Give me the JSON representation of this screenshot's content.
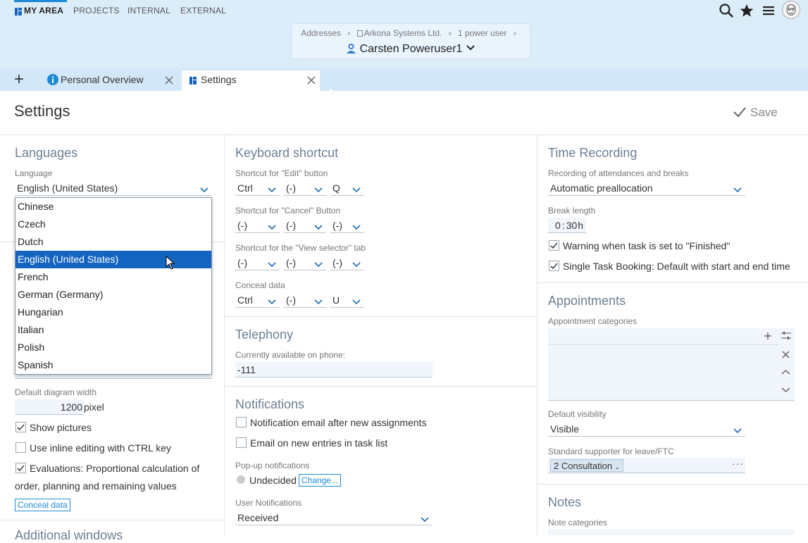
{
  "nav": {
    "items": [
      "MY AREA",
      "PROJECTS",
      "INTERNAL",
      "EXTERNAL"
    ]
  },
  "breadcrumb": {
    "items": [
      "Addresses",
      "Arkona Systems Ltd.",
      "1 power user"
    ],
    "separator": "›",
    "current": "Carsten Poweruser1"
  },
  "tabs": {
    "add": "+",
    "items": [
      {
        "label": "Personal Overview"
      },
      {
        "label": "Settings"
      }
    ]
  },
  "page": {
    "title": "Settings",
    "save_label": "Save"
  },
  "languages": {
    "heading": "Languages",
    "language_label": "Language",
    "language_value": "English (United States)",
    "options": [
      "Chinese",
      "Czech",
      "Dutch",
      "English (United States)",
      "French",
      "German (Germany)",
      "Hungarian",
      "Italian",
      "Polish",
      "Spanish"
    ],
    "selected_index": 3,
    "diagram_width_label": "Default diagram width",
    "diagram_width_value": "1200",
    "diagram_width_unit": "pixel",
    "show_pictures": "Show pictures",
    "inline_editing": "Use inline editing with CTRL key",
    "evaluations": "Evaluations: Proportional calculation of",
    "evaluations_line2": "order, planning and remaining values",
    "conceal_button": "Conceal data",
    "next_heading": "Additional windows"
  },
  "keyboard": {
    "heading": "Keyboard shortcut",
    "rows": [
      {
        "label": "Shortcut for \"Edit\" button",
        "v": [
          "Ctrl",
          "(-)",
          "Q"
        ]
      },
      {
        "label": "Shortcut for \"Cancel\" Button",
        "v": [
          "(-)",
          "(-)",
          "(-)"
        ]
      },
      {
        "label": "Shortcut for the \"View selector\" tab",
        "v": [
          "(-)",
          "(-)",
          "(-)"
        ]
      },
      {
        "label": "Conceal data",
        "v": [
          "Ctrl",
          "(-)",
          "U"
        ]
      }
    ]
  },
  "telephony": {
    "heading": "Telephony",
    "label": "Currently available on phone:",
    "value": "-111"
  },
  "notifications": {
    "heading": "Notifications",
    "email_assign": "Notification email after new assignments",
    "email_task": "Email on new entries in task list",
    "popup_label": "Pop-up notifications",
    "popup_value": "Undecided",
    "change": "Change...",
    "user_label": "User Notifications",
    "user_value": "Received"
  },
  "time": {
    "heading": "Time Recording",
    "rec_label": "Recording of attendances and breaks",
    "rec_value": "Automatic preallocation",
    "break_label": "Break length",
    "break_h": "0",
    "break_m": "30",
    "break_unit": "h",
    "warn": "Warning when task is set to \"Finished\"",
    "single": "Single Task Booking: Default with start and end time"
  },
  "appointments": {
    "heading": "Appointments",
    "cat_label": "Appointment categories",
    "vis_label": "Default visibility",
    "vis_value": "Visible",
    "sup_label": "Standard supporter for leave/FTC",
    "sup_value": "2 Consultation"
  },
  "notes": {
    "heading": "Notes",
    "cat_label": "Note categories"
  },
  "colors": {
    "accent": "#1e8ad6",
    "selected": "#1565c0",
    "topbar": "#dcedfa"
  }
}
